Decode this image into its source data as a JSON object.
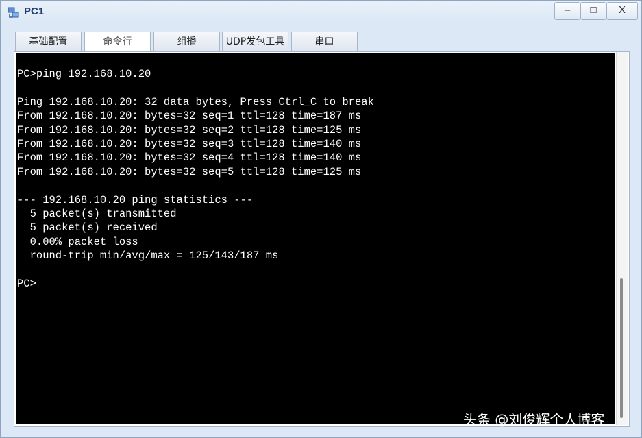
{
  "window": {
    "title": "PC1",
    "controls": {
      "minimize": "–",
      "maximize": "□",
      "close": "X"
    }
  },
  "tabs": [
    {
      "label": "基础配置",
      "active": false
    },
    {
      "label": "命令行",
      "active": true
    },
    {
      "label": "组播",
      "active": false
    },
    {
      "label": "UDP发包工具",
      "active": false
    },
    {
      "label": "串口",
      "active": false
    }
  ],
  "terminal": {
    "lines": [
      "PC>ping 192.168.10.20",
      "",
      "Ping 192.168.10.20: 32 data bytes, Press Ctrl_C to break",
      "From 192.168.10.20: bytes=32 seq=1 ttl=128 time=187 ms",
      "From 192.168.10.20: bytes=32 seq=2 ttl=128 time=125 ms",
      "From 192.168.10.20: bytes=32 seq=3 ttl=128 time=140 ms",
      "From 192.168.10.20: bytes=32 seq=4 ttl=128 time=140 ms",
      "From 192.168.10.20: bytes=32 seq=5 ttl=128 time=125 ms",
      "",
      "--- 192.168.10.20 ping statistics ---",
      "  5 packet(s) transmitted",
      "  5 packet(s) received",
      "  0.00% packet loss",
      "  round-trip min/avg/max = 125/143/187 ms",
      "",
      "PC>"
    ]
  },
  "watermark": "头条 @刘俊辉个人博客",
  "colors": {
    "terminal_bg": "#000000",
    "terminal_fg": "#ffffff",
    "title_text": "#1e3d6b"
  },
  "icons": {
    "app": "network-pc-icon"
  }
}
